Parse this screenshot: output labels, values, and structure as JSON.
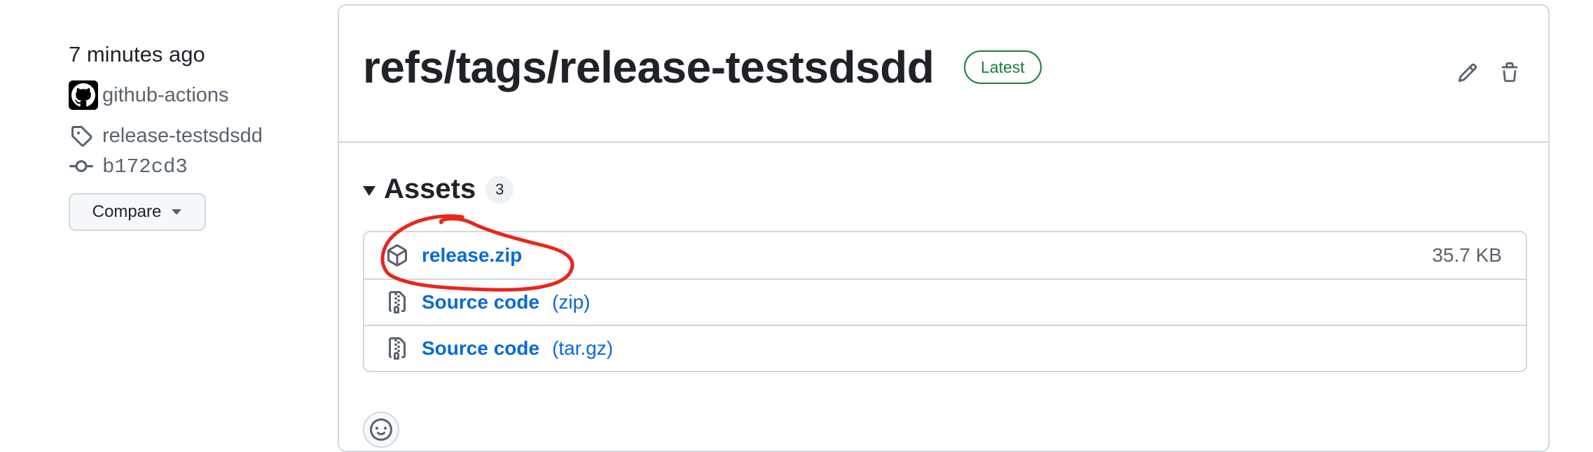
{
  "sidebar": {
    "timestamp": "7 minutes ago",
    "author": "github-actions",
    "tag": "release-testsdsdd",
    "commit": "b172cd3",
    "compare_label": "Compare"
  },
  "release": {
    "title": "refs/tags/release-testsdsdd",
    "badge": "Latest"
  },
  "assets": {
    "title": "Assets",
    "count": "3",
    "items": [
      {
        "icon": "package-icon",
        "name": "release.zip",
        "suffix": "",
        "size": "35.7 KB"
      },
      {
        "icon": "file-zip-icon",
        "name": "Source code",
        "suffix": "(zip)",
        "size": ""
      },
      {
        "icon": "file-zip-icon",
        "name": "Source code",
        "suffix": "(tar.gz)",
        "size": ""
      }
    ]
  },
  "colors": {
    "link": "#0969da",
    "latest_green": "#1a7f37",
    "annotation_red": "#e8261b",
    "muted_text": "#59636e",
    "border": "#d1d9e0"
  }
}
